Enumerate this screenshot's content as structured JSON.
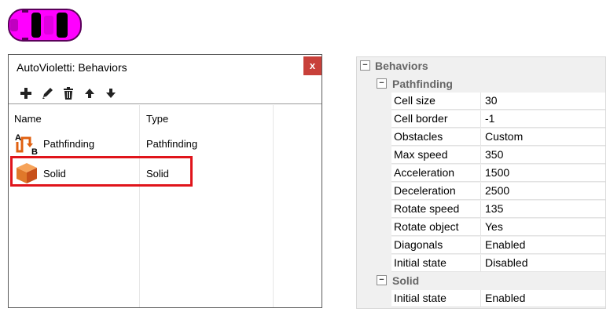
{
  "dialog": {
    "title": "AutoVioletti: Behaviors",
    "close_label": "x",
    "toolbar": [
      "add-icon",
      "edit-icon",
      "delete-icon",
      "move-up-icon",
      "move-down-icon"
    ],
    "columns": [
      "Name",
      "Type"
    ],
    "rows": [
      {
        "name": "Pathfinding",
        "type": "Pathfinding",
        "icon": "pathfinding-icon"
      },
      {
        "name": "Solid",
        "type": "Solid",
        "icon": "solid-cube-icon"
      }
    ]
  },
  "props": {
    "behaviors_label": "Behaviors",
    "pathfinding": {
      "label": "Pathfinding",
      "items": [
        {
          "key": "Cell size",
          "value": "30"
        },
        {
          "key": "Cell border",
          "value": "-1"
        },
        {
          "key": "Obstacles",
          "value": "Custom"
        },
        {
          "key": "Max speed",
          "value": "350"
        },
        {
          "key": "Acceleration",
          "value": "1500"
        },
        {
          "key": "Deceleration",
          "value": "2500"
        },
        {
          "key": "Rotate speed",
          "value": "135"
        },
        {
          "key": "Rotate object",
          "value": "Yes"
        },
        {
          "key": "Diagonals",
          "value": "Enabled"
        },
        {
          "key": "Initial state",
          "value": "Disabled"
        }
      ]
    },
    "solid": {
      "label": "Solid",
      "items": [
        {
          "key": "Initial state",
          "value": "Enabled"
        }
      ]
    },
    "collapse_glyph": "−"
  },
  "colors": {
    "car": "#ff00ff",
    "highlight": "#e0141b",
    "close": "#c8403a"
  }
}
